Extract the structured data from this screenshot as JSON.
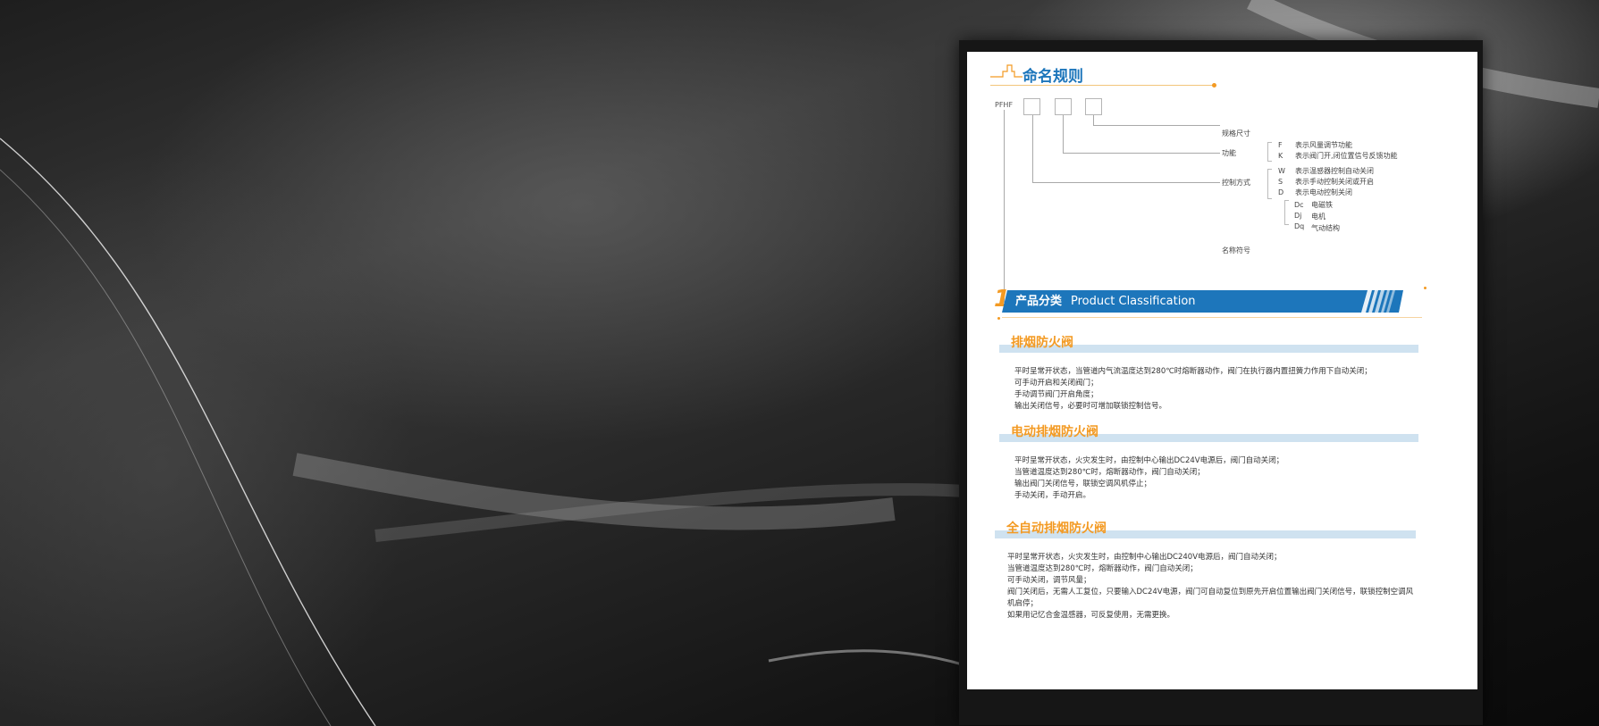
{
  "naming": {
    "title": "命名规则",
    "prefix": "PFHF",
    "labels": {
      "size": "规格尺寸",
      "function": "功能",
      "control": "控制方式",
      "name_code": "名称符号"
    },
    "function_codes": [
      {
        "code": "F",
        "desc": "表示风量调节功能"
      },
      {
        "code": "K",
        "desc": "表示阀门开,闭位置信号反馈功能"
      }
    ],
    "control_codes": [
      {
        "code": "W",
        "desc": "表示温感器控制自动关闭"
      },
      {
        "code": "S",
        "desc": "表示手动控制关闭或开启"
      },
      {
        "code": "D",
        "desc": "表示电动控制关闭"
      }
    ],
    "drive_codes": [
      {
        "code": "Dc",
        "desc": "电磁铁"
      },
      {
        "code": "Dj",
        "desc": "电机"
      },
      {
        "code": "Dq",
        "desc": "气动结构"
      }
    ]
  },
  "classification": {
    "number": "1",
    "title_cn": "产品分类",
    "title_en": "Product Classification"
  },
  "categories": [
    {
      "name": "排烟防火阀",
      "lines": [
        "平时呈常开状态，当管道内气流温度达到280℃时熔断器动作，阀门在执行器内置扭簧力作用下自动关闭；",
        "可手动开启和关闭阀门；",
        "手动调节阀门开启角度；",
        "输出关闭信号，必要时可增加联锁控制信号。"
      ]
    },
    {
      "name": "电动排烟防火阀",
      "lines": [
        "平时呈常开状态，火灾发生时，由控制中心输出DC24V电源后，阀门自动关闭；",
        "当管道温度达到280℃时，熔断器动作，阀门自动关闭；",
        "输出阀门关闭信号，联锁空调风机停止；",
        "手动关闭，手动开启。"
      ]
    },
    {
      "name": "全自动排烟防火阀",
      "lines": [
        "平时呈常开状态，火灾发生时，由控制中心输出DC240V电源后，阀门自动关闭；",
        "当管道温度达到280℃时，熔断器动作，阀门自动关闭；",
        "可手动关闭，调节风量；",
        "阀门关闭后，无需人工复位，只要输入DC24V电源，阀门可自动复位到原先开启位置输出阀门关闭信号，联锁控制空调风机启停；",
        "如果用记忆合金温感器，可反复使用，无需更换。"
      ]
    }
  ],
  "colors": {
    "brand_blue": "#1d76bb",
    "accent_orange": "#f39a23",
    "light_blue": "#cfe2f0"
  }
}
